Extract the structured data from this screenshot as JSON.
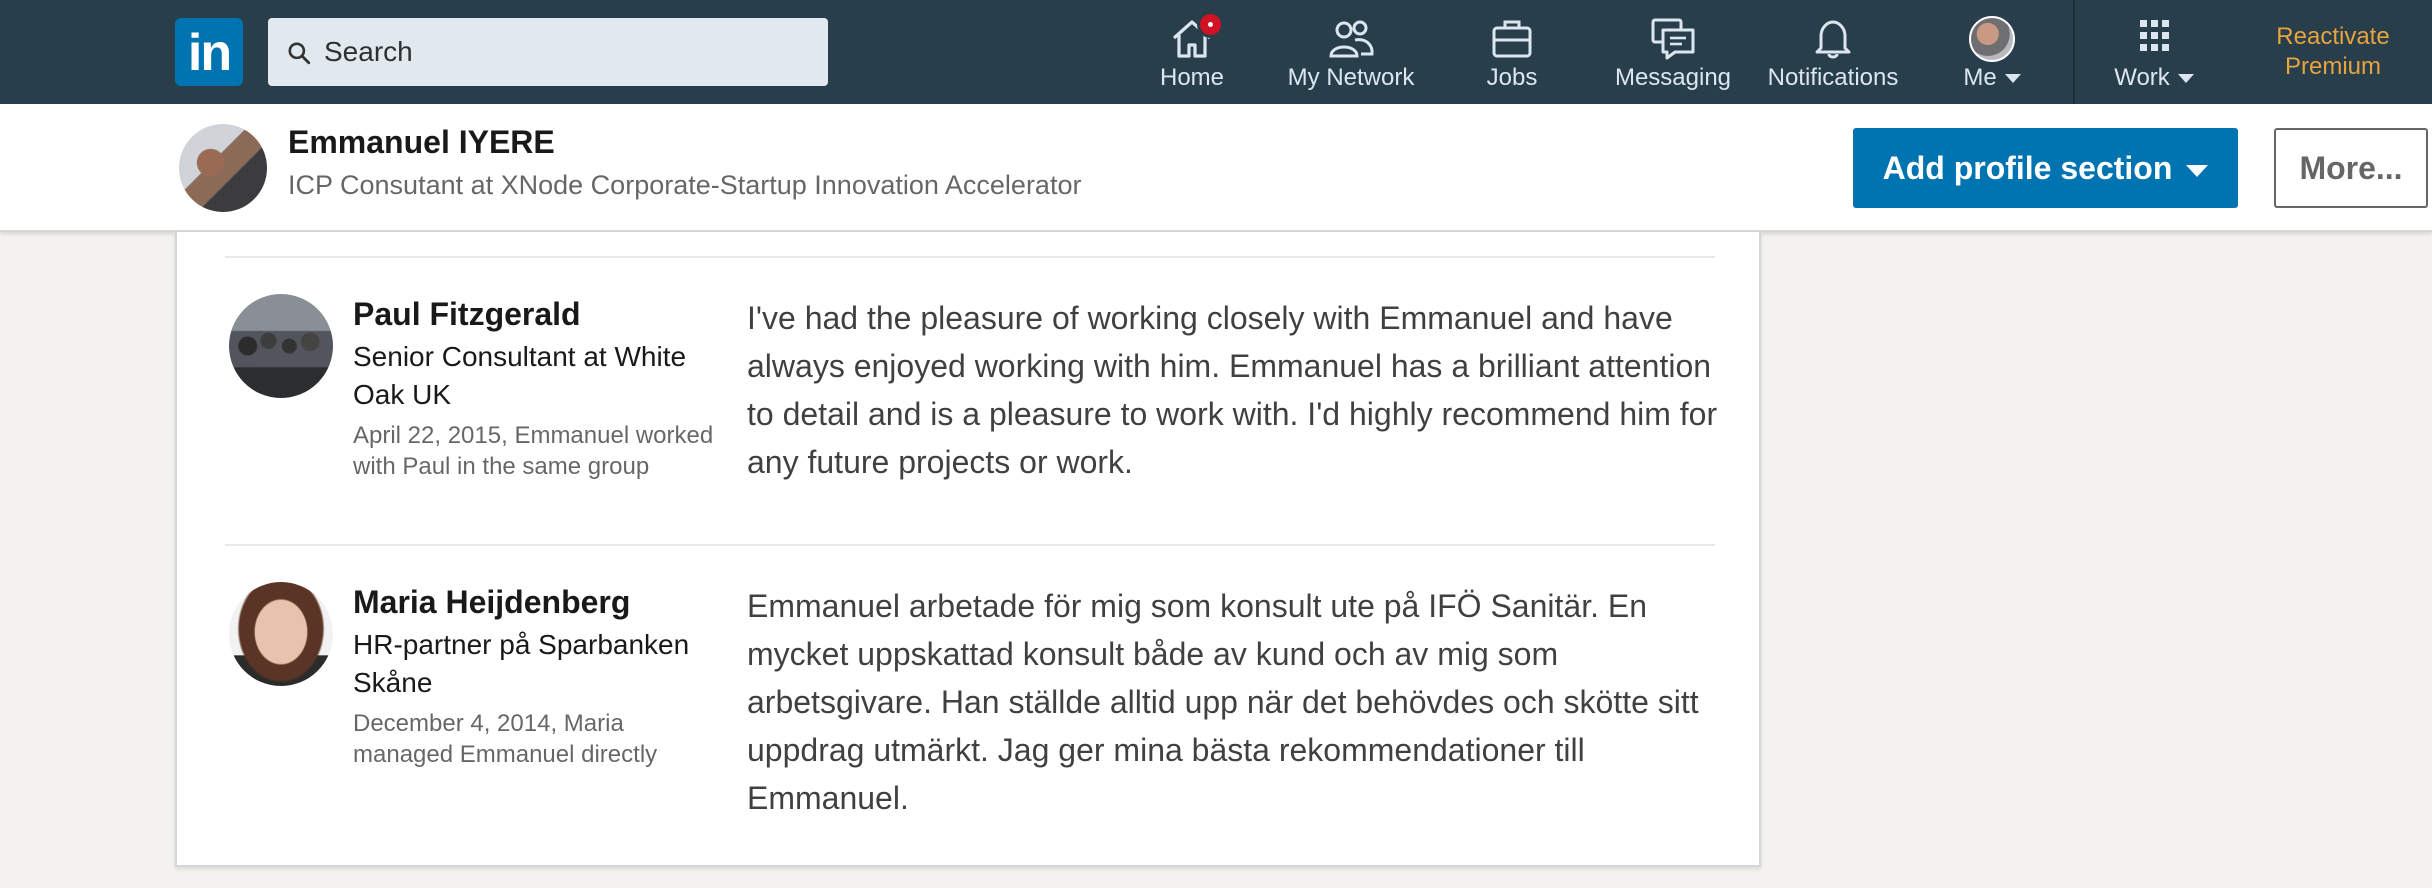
{
  "nav": {
    "logo": "in",
    "search_placeholder": "Search",
    "items": [
      {
        "label": "Home",
        "icon": "home-icon"
      },
      {
        "label": "My Network",
        "icon": "network-icon"
      },
      {
        "label": "Jobs",
        "icon": "briefcase-icon"
      },
      {
        "label": "Messaging",
        "icon": "messaging-icon"
      },
      {
        "label": "Notifications",
        "icon": "bell-icon"
      },
      {
        "label": "Me",
        "icon": "avatar"
      },
      {
        "label": "Work",
        "icon": "grid-icon"
      }
    ],
    "premium": {
      "line1": "Reactivate",
      "line2": "Premium"
    },
    "colors": {
      "bar": "#283e4a",
      "accent": "#0073b1",
      "premium": "#e7a33e",
      "badge": "#d11124"
    }
  },
  "profile_header": {
    "name": "Emmanuel IYERE",
    "headline": "ICP Consutant at XNode Corporate-Startup Innovation Accelerator",
    "add_section_label": "Add profile section",
    "more_label": "More..."
  },
  "recommendations": [
    {
      "name": "Paul Fitzgerald",
      "title": "Senior Consultant at White Oak UK",
      "meta": "April 22, 2015, Emmanuel worked with Paul in the same group",
      "text": "I've had the pleasure of working closely with Emmanuel and have always enjoyed working with him. Emmanuel has a brilliant attention to detail and is a pleasure to work with. I'd highly recommend him for any future projects or work."
    },
    {
      "name": "Maria Heijdenberg",
      "title": "HR-partner på Sparbanken Skåne",
      "meta": "December 4, 2014, Maria managed Emmanuel directly",
      "text": "Emmanuel arbetade för mig som konsult ute på IFÖ Sanitär. En mycket uppskattad konsult både av kund och av mig som arbetsgivare. Han ställde alltid upp när det behövdes och skötte sitt uppdrag utmärkt. Jag ger mina bästa rekommendationer till Emmanuel."
    }
  ]
}
